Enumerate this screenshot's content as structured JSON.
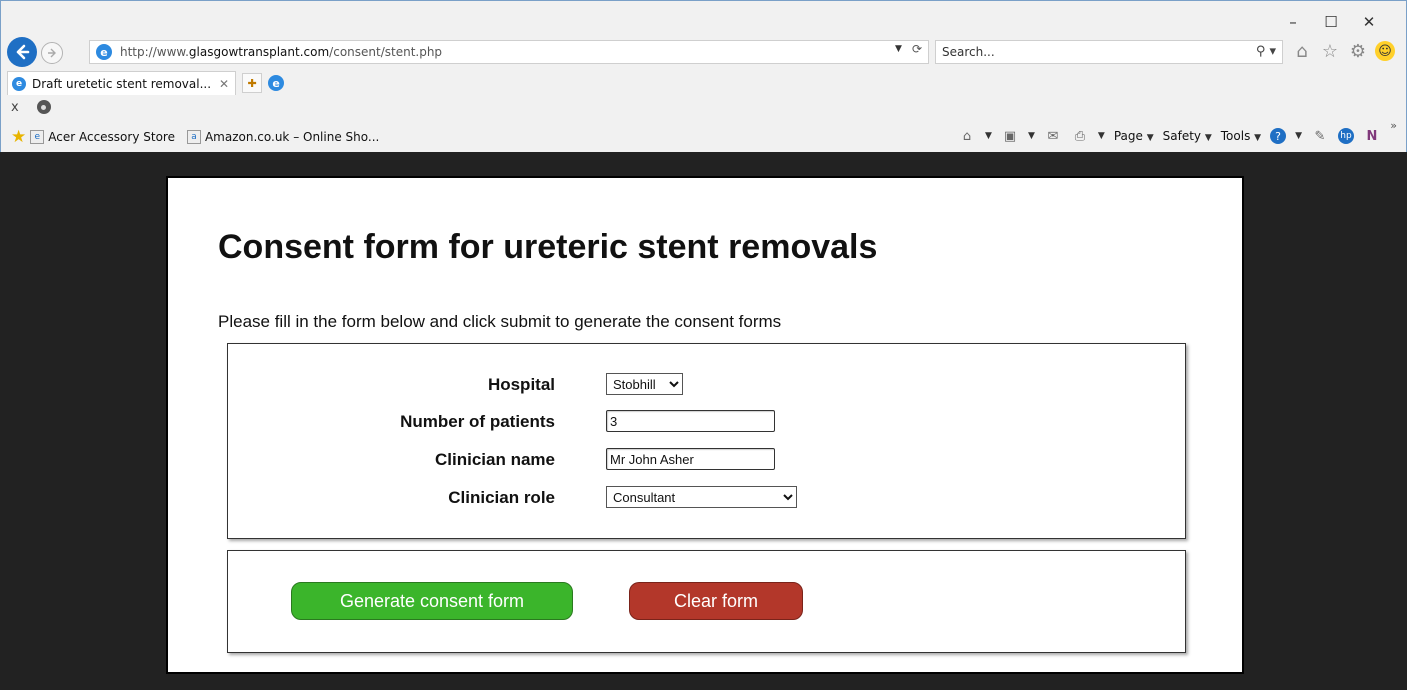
{
  "window": {
    "minimize": "–",
    "maximize": "☐",
    "close": "✕"
  },
  "address_bar": {
    "url_prefix": "http://www.",
    "url_domain": "glasgowtransplant.com",
    "url_path": "/consent/stent.php"
  },
  "search": {
    "placeholder": "Search..."
  },
  "tabs": [
    {
      "label": "Draft uretetic stent removal..."
    }
  ],
  "favorites": [
    {
      "label": "Acer Accessory Store"
    },
    {
      "label": "Amazon.co.uk – Online Sho..."
    }
  ],
  "command_bar": {
    "page": "Page",
    "safety": "Safety",
    "tools": "Tools"
  },
  "page": {
    "title": "Consent form for ureteric stent removals",
    "intro": "Please fill in the form below and click submit to generate the consent forms",
    "fields": {
      "hospital": {
        "label": "Hospital",
        "value": "Stobhill"
      },
      "patients": {
        "label": "Number of patients",
        "value": "3"
      },
      "clinician_name": {
        "label": "Clinician name",
        "value": "Mr John Asher"
      },
      "clinician_role": {
        "label": "Clinician role",
        "value": "Consultant"
      }
    },
    "buttons": {
      "generate": "Generate consent form",
      "clear": "Clear form"
    }
  },
  "colors": {
    "generate_button": "#3bb52b",
    "clear_button": "#b3372a",
    "page_background": "#222222"
  }
}
